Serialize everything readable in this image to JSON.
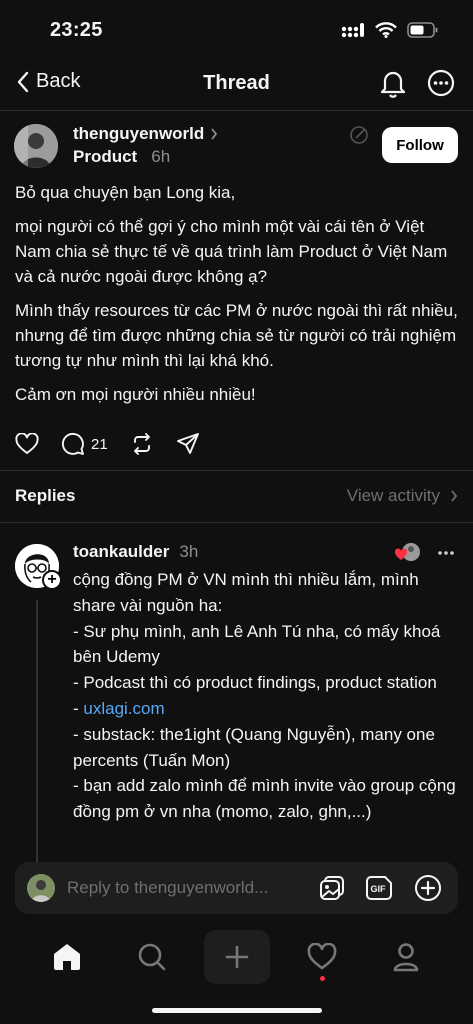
{
  "status": {
    "time": "23:25"
  },
  "nav": {
    "back_label": "Back",
    "title": "Thread"
  },
  "post": {
    "author": "thenguyenworld",
    "tag": "Product",
    "time": "6h",
    "follow_label": "Follow",
    "paragraphs": [
      "Bỏ qua chuyện bạn Long kia,",
      "mọi người có thể gợi ý cho mình một vài cái tên ở Việt Nam chia sẻ thực tế về quá trình làm Product ở Việt Nam và cả nước ngoài được không ạ?",
      "Mình thấy resources từ các PM ở nước ngoài thì rất nhiều, nhưng để tìm được những chia sẻ từ người có trải nghiệm tương tự như mình thì lại khá khó.",
      "Cảm ơn mọi người nhiều nhiều!"
    ],
    "reply_count": "21"
  },
  "replies": {
    "title": "Replies",
    "view_activity": "View activity"
  },
  "reply": {
    "author": "toankaulder",
    "time": "3h",
    "lines": [
      "cộng đồng PM ở VN mình thì nhiều lắm, mình share vài nguồn ha:",
      "- Sư phụ mình, anh Lê Anh Tú nha, có mấy khoá bên Udemy",
      "- Podcast thì có product findings, product station",
      "- ",
      "- substack: the1ight (Quang Nguyễn), many one percents (Tuấn Mon)",
      "- bạn add zalo mình để mình invite vào group cộng đồng pm ở vn nha (momo, zalo, ghn,...)"
    ],
    "link": "uxlagi.com"
  },
  "reply_bar": {
    "placeholder": "Reply to thenguyenworld..."
  },
  "colors": {
    "background": "#101010",
    "link": "#5aa8f5",
    "notification_dot": "#ff3040"
  }
}
